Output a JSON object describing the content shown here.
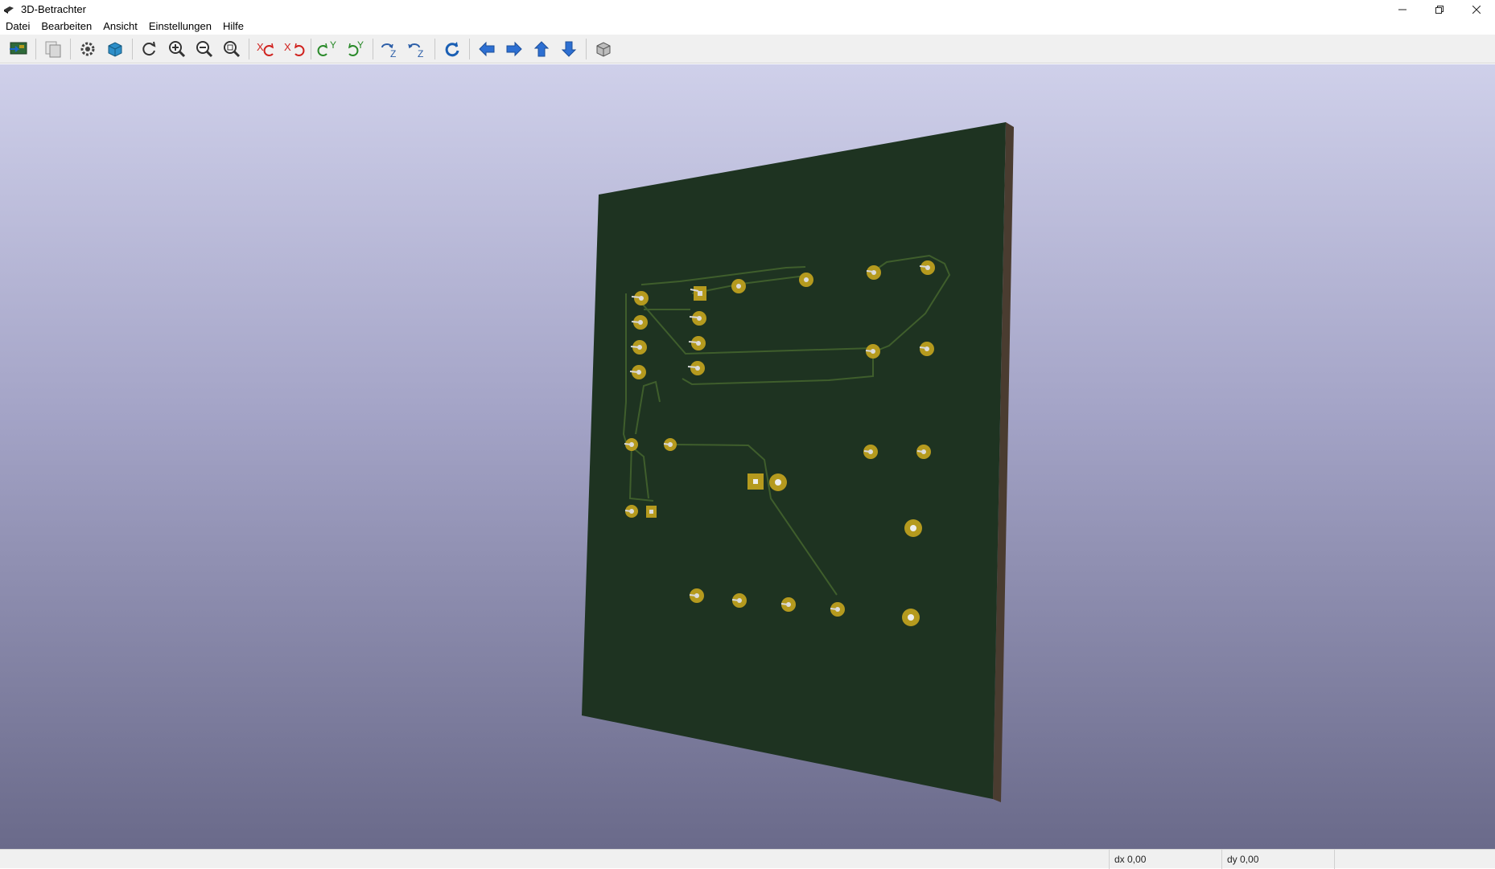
{
  "window": {
    "title": "3D-Betrachter"
  },
  "menu": {
    "items": [
      "Datei",
      "Bearbeiten",
      "Ansicht",
      "Einstellungen",
      "Hilfe"
    ]
  },
  "toolbar": {
    "buttons": [
      "reload-board-icon",
      "copy-image-icon",
      "settings-icon",
      "raytracing-icon",
      "redraw-icon",
      "zoom-in-icon",
      "zoom-out-icon",
      "zoom-fit-icon",
      "rotate-x-cw-icon",
      "rotate-x-ccw-icon",
      "rotate-y-cw-icon",
      "rotate-y-ccw-icon",
      "rotate-z-cw-icon",
      "rotate-z-ccw-icon",
      "flip-board-icon",
      "pan-left-icon",
      "pan-right-icon",
      "pan-up-icon",
      "pan-down-icon",
      "ortho-view-icon"
    ]
  },
  "status": {
    "dx": "dx 0,00",
    "dy": "dy 0,00"
  },
  "colors": {
    "board": "#1e3321",
    "board_edge": "#4a3c30",
    "copper_pad": "#b59a1e",
    "track": "#3f5e2c",
    "arrow_blue": "#2d6fd2"
  }
}
